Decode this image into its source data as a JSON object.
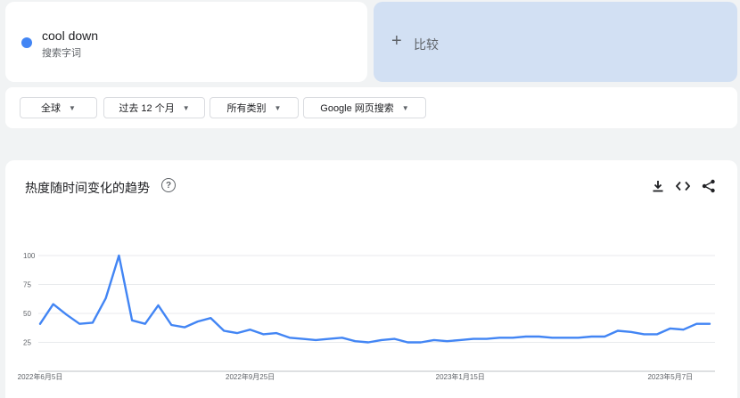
{
  "term": {
    "name": "cool down",
    "subtitle": "搜索字词",
    "color": "#4285f4"
  },
  "compare": {
    "label": "比较",
    "icon": "plus-icon"
  },
  "filters": [
    {
      "label": "全球"
    },
    {
      "label": "过去 12 个月"
    },
    {
      "label": "所有类别"
    },
    {
      "label": "Google 网页搜索"
    }
  ],
  "chart_panel": {
    "title": "热度随时间变化的趋势",
    "help_icon": "help-circle-icon",
    "actions": [
      "download-icon",
      "embed-code-icon",
      "share-icon"
    ]
  },
  "chart_data": {
    "type": "line",
    "title": "",
    "xlabel": "",
    "ylabel": "",
    "ylim": [
      0,
      100
    ],
    "y_ticks": [
      25,
      50,
      75,
      100
    ],
    "x_tick_labels": [
      "2022年6月5日",
      "2022年9月25日",
      "2023年1月15日",
      "2023年5月7日"
    ],
    "x_range": [
      "2022-06-05",
      "2023-05-28"
    ],
    "grid": true,
    "series": [
      {
        "color": "#4285f4",
        "x": [
          "2022-06-05",
          "2022-06-12",
          "2022-06-19",
          "2022-06-26",
          "2022-07-03",
          "2022-07-10",
          "2022-07-17",
          "2022-07-24",
          "2022-07-31",
          "2022-08-07",
          "2022-08-14",
          "2022-08-21",
          "2022-08-28",
          "2022-09-04",
          "2022-09-11",
          "2022-09-18",
          "2022-09-25",
          "2022-10-02",
          "2022-10-09",
          "2022-10-16",
          "2022-10-23",
          "2022-10-30",
          "2022-11-06",
          "2022-11-13",
          "2022-11-20",
          "2022-11-27",
          "2022-12-04",
          "2022-12-11",
          "2022-12-18",
          "2022-12-25",
          "2023-01-01",
          "2023-01-08",
          "2023-01-15",
          "2023-01-22",
          "2023-01-29",
          "2023-02-05",
          "2023-02-12",
          "2023-02-19",
          "2023-02-26",
          "2023-03-05",
          "2023-03-12",
          "2023-03-19",
          "2023-03-26",
          "2023-04-02",
          "2023-04-09",
          "2023-04-16",
          "2023-04-23",
          "2023-04-30",
          "2023-05-07",
          "2023-05-14",
          "2023-05-21",
          "2023-05-28"
        ],
        "values": [
          41,
          58,
          49,
          41,
          42,
          63,
          100,
          44,
          41,
          57,
          40,
          38,
          43,
          46,
          35,
          33,
          36,
          32,
          33,
          29,
          28,
          27,
          28,
          29,
          26,
          25,
          27,
          28,
          25,
          25,
          27,
          26,
          27,
          28,
          28,
          29,
          29,
          30,
          30,
          29,
          29,
          29,
          30,
          30,
          35,
          34,
          32,
          32,
          37,
          36,
          41,
          41
        ]
      }
    ]
  }
}
